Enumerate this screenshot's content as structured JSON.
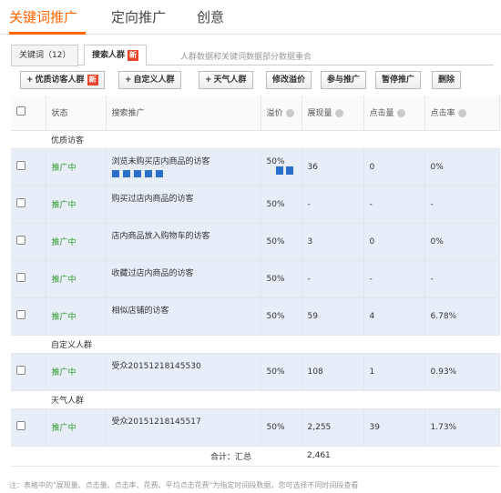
{
  "top_tabs": [
    "关键词推广",
    "定向推广",
    "创意"
  ],
  "sub_tabs": {
    "keywords": "关键词（12）",
    "audiences": "搜索人群",
    "new_badge": "新",
    "note": "人群数据和关键词数据部分数据重合"
  },
  "toolbar": {
    "quality_visitors": "优质访客人群",
    "custom_audience": "自定义人群",
    "weather_audience": "天气人群",
    "edit_bid": "修改溢价",
    "join_promo": "参与推广",
    "pause_promo": "暂停推广",
    "delete": "删除"
  },
  "columns": [
    "状态",
    "搜索推广",
    "溢价",
    "展现量",
    "点击量",
    "点击率"
  ],
  "groups": [
    {
      "name": "优质访客",
      "rows": [
        {
          "status": "推广中",
          "name": "浏览未购买店内商品的访客",
          "bid": "50%",
          "impr": "36",
          "clicks": "0",
          "ctr": "0%"
        },
        {
          "status": "推广中",
          "name": "购买过店内商品的访客",
          "bid": "50%",
          "impr": "-",
          "clicks": "-",
          "ctr": "-"
        },
        {
          "status": "推广中",
          "name": "店内商品放入购物车的访客",
          "bid": "50%",
          "impr": "3",
          "clicks": "0",
          "ctr": "0%"
        },
        {
          "status": "推广中",
          "name": "收藏过店内商品的访客",
          "bid": "50%",
          "impr": "-",
          "clicks": "-",
          "ctr": "-"
        },
        {
          "status": "推广中",
          "name": "相似店铺的访客",
          "bid": "50%",
          "impr": "59",
          "clicks": "4",
          "ctr": "6.78%"
        }
      ]
    },
    {
      "name": "自定义人群",
      "rows": [
        {
          "status": "推广中",
          "name": "受众20151218145530",
          "bid": "50%",
          "impr": "108",
          "clicks": "1",
          "ctr": "0.93%"
        }
      ]
    },
    {
      "name": "天气人群",
      "rows": [
        {
          "status": "推广中",
          "name": "受众20151218145517",
          "bid": "50%",
          "impr": "2,255",
          "clicks": "39",
          "ctr": "1.73%"
        }
      ]
    }
  ],
  "total": {
    "label": "合计：汇总",
    "impr": "2,461"
  },
  "footer_note": "注：表格中的\"展现量、点击量、点击率、花费、平均点击花费\"为指定时间段数据，您可选择不同时间段查看"
}
